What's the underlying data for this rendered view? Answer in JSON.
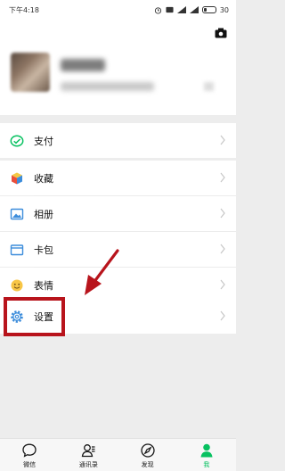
{
  "status_bar": {
    "time": "下午4:18",
    "battery": "30",
    "battery_level": 0.3
  },
  "profile": {
    "camera_icon": "camera-icon",
    "avatar": "avatar-blurred"
  },
  "menu": {
    "pay": {
      "label": "支付",
      "icon": "wallet-icon"
    },
    "favorites": {
      "label": "收藏",
      "icon": "cube-icon"
    },
    "album": {
      "label": "相册",
      "icon": "image-icon"
    },
    "cards": {
      "label": "卡包",
      "icon": "card-icon"
    },
    "stickers": {
      "label": "表情",
      "icon": "smiley-icon"
    },
    "settings": {
      "label": "设置",
      "icon": "gear-icon"
    }
  },
  "tabs": [
    {
      "label": "微信",
      "icon": "chat-icon"
    },
    {
      "label": "通讯录",
      "icon": "contacts-icon"
    },
    {
      "label": "发现",
      "icon": "compass-icon"
    },
    {
      "label": "我",
      "icon": "person-icon"
    }
  ],
  "colors": {
    "accent": "#07c160",
    "highlight": "#b8141c",
    "background": "#ededed"
  }
}
